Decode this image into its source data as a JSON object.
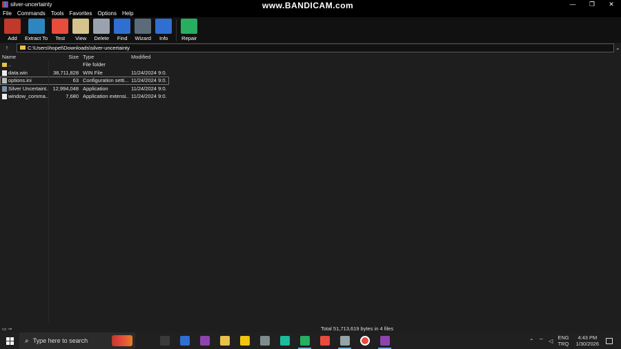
{
  "window": {
    "title": "silver-uncertainty",
    "watermark": "www.BANDICAM.com",
    "controls": [
      "—",
      "❐",
      "✕"
    ]
  },
  "menu": [
    "File",
    "Commands",
    "Tools",
    "Favorites",
    "Options",
    "Help"
  ],
  "toolbar": [
    {
      "label": "Add",
      "icon": "add-archive-icon",
      "color": "#c0392b"
    },
    {
      "label": "Extract To",
      "icon": "extract-folder-icon",
      "color": "#2e86c1"
    },
    {
      "label": "Test",
      "icon": "test-clipboard-icon",
      "color": "#e74c3c"
    },
    {
      "label": "View",
      "icon": "view-book-icon",
      "color": "#d4c38a"
    },
    {
      "label": "Delete",
      "icon": "trash-icon",
      "color": "#9aa3ad"
    },
    {
      "label": "Find",
      "icon": "magnifier-icon",
      "color": "#2f6fd1"
    },
    {
      "label": "Wizard",
      "icon": "wizard-wand-icon",
      "color": "#5b6b7a"
    },
    {
      "label": "Info",
      "icon": "info-icon",
      "color": "#2f6fd1"
    },
    {
      "label": "Repair",
      "icon": "repair-icon",
      "color": "#27ae60"
    }
  ],
  "address": {
    "path": "C:\\Users\\hopet\\Downloads\\silver-uncertainty",
    "up_glyph": "↑",
    "dropdown_glyph": "⌄"
  },
  "columns": {
    "name": "Name",
    "size": "Size",
    "type": "Type",
    "modified": "Modified"
  },
  "files": [
    {
      "name": "..",
      "size": "",
      "type": "File folder",
      "modified": "",
      "icon": "folder"
    },
    {
      "name": "data.win",
      "size": "38,711,828",
      "type": "WIN File",
      "modified": "11/24/2024 9:0...",
      "icon": "doc"
    },
    {
      "name": "options.ini",
      "size": "63",
      "type": "Configuration setti...",
      "modified": "11/24/2024 9:0...",
      "icon": "ini"
    },
    {
      "name": "Silver Uncertaint...",
      "size": "12,994,048",
      "type": "Application",
      "modified": "11/24/2024 9:0...",
      "icon": "app"
    },
    {
      "name": "window_comma...",
      "size": "7,680",
      "type": "Application extensi...",
      "modified": "11/24/2024 9:0...",
      "icon": "doc"
    }
  ],
  "status": {
    "total": "Total 51,713,619 bytes in 4 files"
  },
  "taskbar": {
    "search_placeholder": "Type here to search",
    "apps": [
      {
        "icon": "task-view-icon",
        "color": "#3a3a3a"
      },
      {
        "icon": "mail-icon",
        "color": "#2f6fd1"
      },
      {
        "icon": "copilot-icon",
        "color": "#8e44ad"
      },
      {
        "icon": "file-explorer-icon",
        "color": "#e8c14a"
      },
      {
        "icon": "store-icon",
        "color": "#f1c40f"
      },
      {
        "icon": "display-icon",
        "color": "#7f8c8d"
      },
      {
        "icon": "edge-icon",
        "color": "#1abc9c"
      },
      {
        "icon": "chrome-icon",
        "color": "#27ae60"
      },
      {
        "icon": "chrome-icon",
        "color": "#e74c3c"
      },
      {
        "icon": "app-icon",
        "color": "#95a5a6"
      },
      {
        "icon": "bandicam-record-icon",
        "color": "#e74c3c"
      },
      {
        "icon": "winrar-icon",
        "color": "#8e44ad"
      }
    ],
    "active_apps": [
      7,
      9,
      11
    ],
    "lang_top": "ENG",
    "lang_bottom": "TRQ",
    "time": "4:43 PM",
    "date": "1/30/2026"
  }
}
